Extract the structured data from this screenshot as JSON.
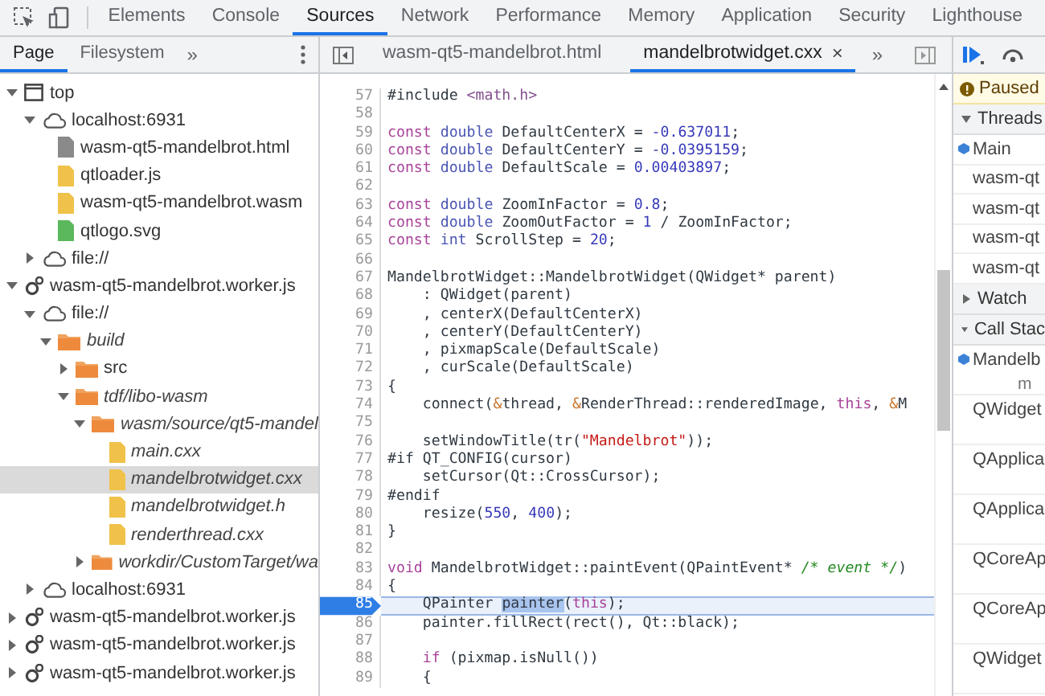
{
  "toolbar": {
    "tabs": [
      {
        "label": "Elements",
        "selected": false
      },
      {
        "label": "Console",
        "selected": false
      },
      {
        "label": "Sources",
        "selected": true
      },
      {
        "label": "Network",
        "selected": false
      },
      {
        "label": "Performance",
        "selected": false
      },
      {
        "label": "Memory",
        "selected": false
      },
      {
        "label": "Application",
        "selected": false
      },
      {
        "label": "Security",
        "selected": false
      },
      {
        "label": "Lighthouse",
        "selected": false
      }
    ]
  },
  "navigator": {
    "tabs": [
      {
        "label": "Page",
        "selected": true
      },
      {
        "label": "Filesystem",
        "selected": false
      }
    ],
    "more": "»",
    "tree": [
      {
        "label": "top",
        "kind": "frame",
        "expanded": true,
        "selected": false,
        "mapped": false,
        "children": [
          {
            "label": "localhost:6931",
            "kind": "cloud",
            "expanded": true,
            "selected": false,
            "mapped": false,
            "children": [
              {
                "label": "wasm-qt5-mandelbrot.html",
                "kind": "file",
                "color": "#8a8a8a",
                "selected": false,
                "mapped": false
              },
              {
                "label": "qtloader.js",
                "kind": "file",
                "color": "#f0c24a",
                "selected": false,
                "mapped": false
              },
              {
                "label": "wasm-qt5-mandelbrot.wasm",
                "kind": "file",
                "color": "#f0c24a",
                "selected": false,
                "mapped": false
              },
              {
                "label": "qtlogo.svg",
                "kind": "file",
                "color": "#5cb85c",
                "selected": false,
                "mapped": false
              }
            ]
          },
          {
            "label": "file://",
            "kind": "cloud",
            "expanded": false,
            "selected": false,
            "mapped": false
          }
        ]
      },
      {
        "label": "wasm-qt5-mandelbrot.worker.js",
        "kind": "gear",
        "expanded": true,
        "selected": false,
        "mapped": false,
        "children": [
          {
            "label": "file://",
            "kind": "cloud",
            "expanded": true,
            "selected": false,
            "mapped": false,
            "children": [
              {
                "label": "build",
                "kind": "folder",
                "expanded": true,
                "selected": false,
                "mapped": true,
                "children": [
                  {
                    "label": "src",
                    "kind": "folder",
                    "expanded": false,
                    "selected": false,
                    "mapped": false
                  },
                  {
                    "label": "tdf/libo-wasm",
                    "kind": "folder",
                    "expanded": true,
                    "selected": false,
                    "mapped": true,
                    "children": [
                      {
                        "label": "wasm/source/qt5-mandel",
                        "kind": "folder",
                        "expanded": true,
                        "selected": false,
                        "mapped": true,
                        "children": [
                          {
                            "label": "main.cxx",
                            "kind": "file",
                            "color": "#f0c24a",
                            "selected": false,
                            "mapped": true
                          },
                          {
                            "label": "mandelbrotwidget.cxx",
                            "kind": "file",
                            "color": "#f0c24a",
                            "selected": true,
                            "mapped": true
                          },
                          {
                            "label": "mandelbrotwidget.h",
                            "kind": "file",
                            "color": "#f0c24a",
                            "selected": false,
                            "mapped": true
                          },
                          {
                            "label": "renderthread.cxx",
                            "kind": "file",
                            "color": "#f0c24a",
                            "selected": false,
                            "mapped": true
                          }
                        ]
                      },
                      {
                        "label": "workdir/CustomTarget/wa",
                        "kind": "folder",
                        "expanded": false,
                        "selected": false,
                        "mapped": true
                      }
                    ]
                  }
                ]
              }
            ]
          },
          {
            "label": "localhost:6931",
            "kind": "cloud",
            "expanded": false,
            "selected": false,
            "mapped": false
          }
        ]
      },
      {
        "label": "wasm-qt5-mandelbrot.worker.js",
        "kind": "gear",
        "expanded": false,
        "selected": false,
        "mapped": false
      },
      {
        "label": "wasm-qt5-mandelbrot.worker.js",
        "kind": "gear",
        "expanded": false,
        "selected": false,
        "mapped": false
      },
      {
        "label": "wasm-qt5-mandelbrot.worker.js",
        "kind": "gear",
        "expanded": false,
        "selected": false,
        "mapped": false
      }
    ]
  },
  "editor": {
    "tabs": [
      {
        "label": "wasm-qt5-mandelbrot.html",
        "selected": false
      },
      {
        "label": "mandelbrotwidget.cxx",
        "selected": true,
        "close": "×"
      }
    ],
    "more": "»",
    "lines": [
      {
        "number": "57",
        "current": false,
        "code": [
          {
            "kind": "plain",
            "text": "#include "
          },
          {
            "kind": "include",
            "text": "<math.h>"
          }
        ]
      },
      {
        "number": "58",
        "current": false
      },
      {
        "number": "59",
        "current": false,
        "code": [
          {
            "kind": "keyword",
            "text": "const "
          },
          {
            "kind": "type",
            "text": "double"
          },
          {
            "kind": "plain",
            "text": " DefaultCenterX = "
          },
          {
            "kind": "number",
            "text": "-0.637011"
          },
          {
            "kind": "plain",
            "text": ";"
          }
        ]
      },
      {
        "number": "60",
        "current": false,
        "code": [
          {
            "kind": "keyword",
            "text": "const "
          },
          {
            "kind": "type",
            "text": "double"
          },
          {
            "kind": "plain",
            "text": " DefaultCenterY = "
          },
          {
            "kind": "number",
            "text": "-0.0395159"
          },
          {
            "kind": "plain",
            "text": ";"
          }
        ]
      },
      {
        "number": "61",
        "current": false,
        "code": [
          {
            "kind": "keyword",
            "text": "const "
          },
          {
            "kind": "type",
            "text": "double"
          },
          {
            "kind": "plain",
            "text": " DefaultScale = "
          },
          {
            "kind": "number",
            "text": "0.00403897"
          },
          {
            "kind": "plain",
            "text": ";"
          }
        ]
      },
      {
        "number": "62",
        "current": false
      },
      {
        "number": "63",
        "current": false,
        "code": [
          {
            "kind": "keyword",
            "text": "const "
          },
          {
            "kind": "type",
            "text": "double"
          },
          {
            "kind": "plain",
            "text": " ZoomInFactor = "
          },
          {
            "kind": "number",
            "text": "0.8"
          },
          {
            "kind": "plain",
            "text": ";"
          }
        ]
      },
      {
        "number": "64",
        "current": false,
        "code": [
          {
            "kind": "keyword",
            "text": "const "
          },
          {
            "kind": "type",
            "text": "double"
          },
          {
            "kind": "plain",
            "text": " ZoomOutFactor = "
          },
          {
            "kind": "number",
            "text": "1"
          },
          {
            "kind": "plain",
            "text": " / ZoomInFactor;"
          }
        ]
      },
      {
        "number": "65",
        "current": false,
        "code": [
          {
            "kind": "keyword",
            "text": "const "
          },
          {
            "kind": "type",
            "text": "int"
          },
          {
            "kind": "plain",
            "text": " ScrollStep = "
          },
          {
            "kind": "number",
            "text": "20"
          },
          {
            "kind": "plain",
            "text": ";"
          }
        ]
      },
      {
        "number": "66",
        "current": false
      },
      {
        "number": "67",
        "current": false,
        "code": [
          {
            "kind": "plain",
            "text": "MandelbrotWidget::MandelbrotWidget(QWidget* parent)"
          }
        ]
      },
      {
        "number": "68",
        "current": false,
        "code": [
          {
            "kind": "plain",
            "text": "    : QWidget(parent)"
          }
        ]
      },
      {
        "number": "69",
        "current": false,
        "code": [
          {
            "kind": "plain",
            "text": "    , centerX(DefaultCenterX)"
          }
        ]
      },
      {
        "number": "70",
        "current": false,
        "code": [
          {
            "kind": "plain",
            "text": "    , centerY(DefaultCenterY)"
          }
        ]
      },
      {
        "number": "71",
        "current": false,
        "code": [
          {
            "kind": "plain",
            "text": "    , pixmapScale(DefaultScale)"
          }
        ]
      },
      {
        "number": "72",
        "current": false,
        "code": [
          {
            "kind": "plain",
            "text": "    , curScale(DefaultScale)"
          }
        ]
      },
      {
        "number": "73",
        "current": false,
        "code": [
          {
            "kind": "plain",
            "text": "{"
          }
        ]
      },
      {
        "number": "74",
        "current": false,
        "code": [
          {
            "kind": "plain",
            "text": "    connect("
          },
          {
            "kind": "amp",
            "text": "&"
          },
          {
            "kind": "plain",
            "text": "thread, "
          },
          {
            "kind": "amp",
            "text": "&"
          },
          {
            "kind": "plain",
            "text": "RenderThread::renderedImage, "
          },
          {
            "kind": "keyword",
            "text": "this"
          },
          {
            "kind": "plain",
            "text": ", "
          },
          {
            "kind": "amp",
            "text": "&"
          },
          {
            "kind": "plain",
            "text": "M"
          }
        ]
      },
      {
        "number": "75",
        "current": false
      },
      {
        "number": "76",
        "current": false,
        "code": [
          {
            "kind": "plain",
            "text": "    setWindowTitle(tr("
          },
          {
            "kind": "string",
            "text": "\"Mandelbrot\""
          },
          {
            "kind": "plain",
            "text": "));"
          }
        ]
      },
      {
        "number": "77",
        "current": false,
        "code": [
          {
            "kind": "plain",
            "text": "#if QT_CONFIG(cursor)"
          }
        ]
      },
      {
        "number": "78",
        "current": false,
        "code": [
          {
            "kind": "plain",
            "text": "    setCursor(Qt::CrossCursor);"
          }
        ]
      },
      {
        "number": "79",
        "current": false,
        "code": [
          {
            "kind": "plain",
            "text": "#endif"
          }
        ]
      },
      {
        "number": "80",
        "current": false,
        "code": [
          {
            "kind": "plain",
            "text": "    resize("
          },
          {
            "kind": "number",
            "text": "550"
          },
          {
            "kind": "plain",
            "text": ", "
          },
          {
            "kind": "number",
            "text": "400"
          },
          {
            "kind": "plain",
            "text": ");"
          }
        ]
      },
      {
        "number": "81",
        "current": false,
        "code": [
          {
            "kind": "plain",
            "text": "}"
          }
        ]
      },
      {
        "number": "82",
        "current": false
      },
      {
        "number": "83",
        "current": false,
        "code": [
          {
            "kind": "keyword",
            "text": "void"
          },
          {
            "kind": "plain",
            "text": " MandelbrotWidget::paintEvent(QPaintEvent* "
          },
          {
            "kind": "comment",
            "text": "/* event */"
          },
          {
            "kind": "plain",
            "text": ")"
          }
        ]
      },
      {
        "number": "84",
        "current": false,
        "code": [
          {
            "kind": "plain",
            "text": "{"
          }
        ]
      },
      {
        "number": "85",
        "current": true,
        "code": [
          {
            "kind": "plain",
            "text": "    QPainter "
          },
          {
            "kind": "selection",
            "text": "painter"
          },
          {
            "kind": "plain",
            "text": "("
          },
          {
            "kind": "keyword",
            "text": "this"
          },
          {
            "kind": "plain",
            "text": ");"
          }
        ]
      },
      {
        "number": "86",
        "current": false,
        "code": [
          {
            "kind": "plain",
            "text": "    painter.fillRect(rect(), Qt::black);"
          }
        ]
      },
      {
        "number": "87",
        "current": false
      },
      {
        "number": "88",
        "current": false,
        "code": [
          {
            "kind": "keyword",
            "text": "    if"
          },
          {
            "kind": "plain",
            "text": " (pixmap.isNull())"
          }
        ]
      },
      {
        "number": "89",
        "current": false,
        "code": [
          {
            "kind": "plain",
            "text": "    {"
          }
        ]
      }
    ]
  },
  "debugger": {
    "status": "Paused",
    "sections": [
      {
        "title": "Threads",
        "expanded": true,
        "items": [
          {
            "label": "Main",
            "selected": true
          },
          {
            "label": "wasm-qt",
            "selected": false
          },
          {
            "label": "wasm-qt",
            "selected": false
          },
          {
            "label": "wasm-qt",
            "selected": false
          },
          {
            "label": "wasm-qt",
            "selected": false
          }
        ]
      },
      {
        "title": "Watch",
        "expanded": false
      },
      {
        "title": "Call Stac",
        "expanded": true,
        "items": [
          {
            "label": "Mandelb",
            "location": "m",
            "selected": true
          },
          {
            "label": "QWidget",
            "selected": false
          },
          {
            "label": "QApplica",
            "selected": false
          },
          {
            "label": "QApplica",
            "selected": false
          },
          {
            "label": "QCoreAp",
            "selected": false
          },
          {
            "label": "QCoreAp",
            "selected": false
          },
          {
            "label": "QWidget",
            "selected": false
          }
        ]
      }
    ]
  }
}
